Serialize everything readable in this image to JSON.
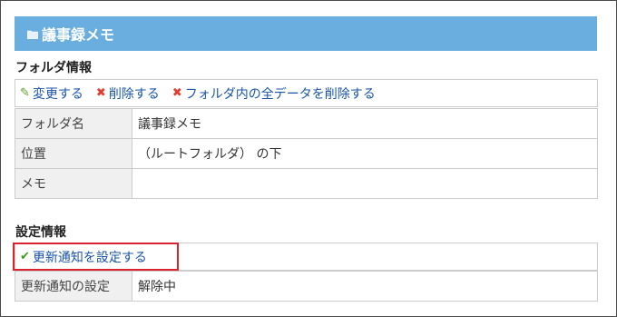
{
  "header": {
    "title": "議事録メモ",
    "icon": "folder-icon"
  },
  "folder_info": {
    "heading": "フォルダ情報",
    "actions": [
      {
        "label": "変更する",
        "icon": "pencil-icon"
      },
      {
        "label": "削除する",
        "icon": "x-icon"
      },
      {
        "label": "フォルダ内の全データを削除する",
        "icon": "x-icon"
      }
    ],
    "rows": [
      {
        "label": "フォルダ名",
        "value": "議事録メモ"
      },
      {
        "label": "位置",
        "value": "（ルートフォルダ） の下"
      },
      {
        "label": "メモ",
        "value": ""
      }
    ]
  },
  "settings_info": {
    "heading": "設定情報",
    "action": {
      "label": "更新通知を設定する",
      "icon": "check-icon"
    },
    "rows": [
      {
        "label": "更新通知の設定",
        "value": "解除中"
      }
    ]
  },
  "colors": {
    "header_bg": "#6aaedf",
    "link": "#1a55a8",
    "highlight": "#d9232d",
    "label_bg": "#f0f0f0"
  }
}
